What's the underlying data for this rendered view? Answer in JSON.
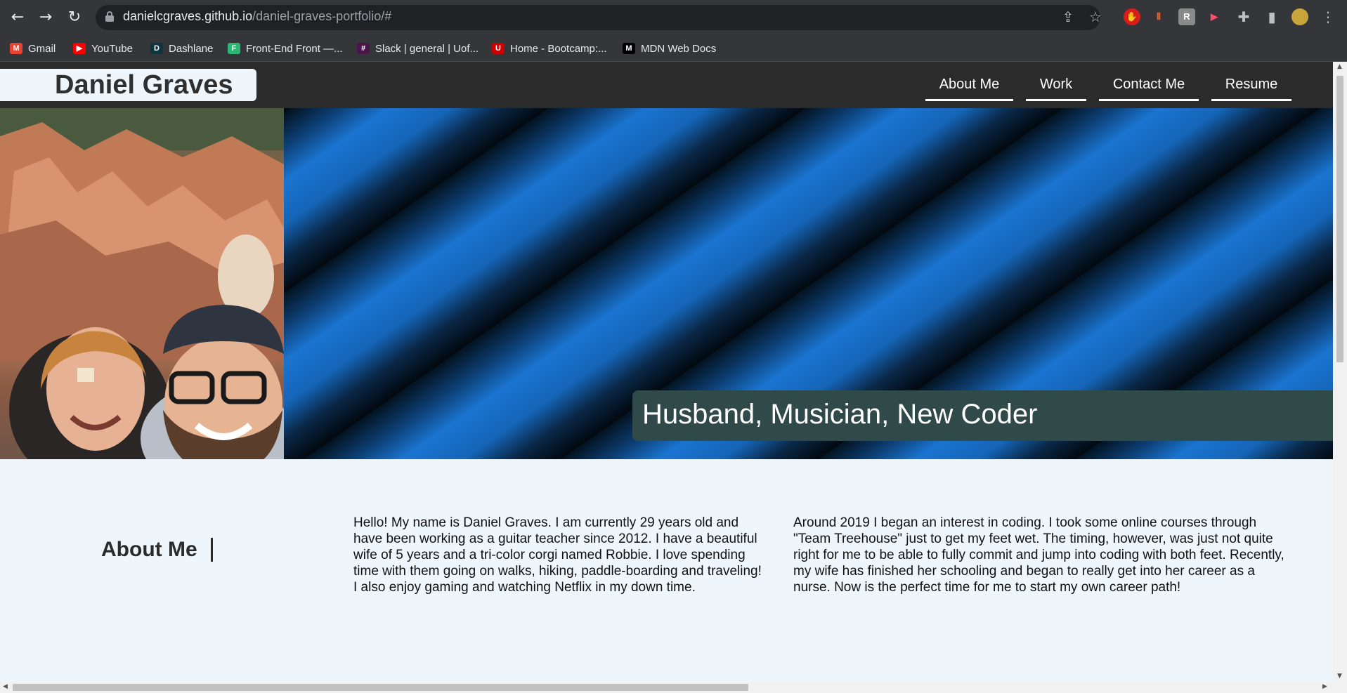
{
  "browser": {
    "url_host": "danielcgraves.github.io",
    "url_path": "/daniel-graves-portfolio/#",
    "bookmarks": [
      {
        "label": "Gmail",
        "icon": "gmail-icon",
        "color": "#ea4335"
      },
      {
        "label": "YouTube",
        "icon": "youtube-icon",
        "color": "#ff0000"
      },
      {
        "label": "Dashlane",
        "icon": "dashlane-icon",
        "color": "#0e353d"
      },
      {
        "label": "Front-End Front —...",
        "icon": "front-end-front-icon",
        "color": "#2bb673"
      },
      {
        "label": "Slack | general | Uof...",
        "icon": "slack-icon",
        "color": "#4a154b"
      },
      {
        "label": "Home - Bootcamp:...",
        "icon": "bootcamp-icon",
        "color": "#cc0000"
      },
      {
        "label": "MDN Web Docs",
        "icon": "mdn-icon",
        "color": "#000000"
      }
    ]
  },
  "site": {
    "brand": "Daniel Graves",
    "nav": [
      "About Me",
      "Work",
      "Contact Me",
      "Resume"
    ],
    "tagline": "Husband, Musician, New Coder",
    "about": {
      "heading": "About Me",
      "paragraph_1": "Hello! My name is Daniel Graves. I am currently 29 years old and have been working as a guitar teacher since 2012. I have a beautiful wife of 5 years and a tri-color corgi named Robbie. I love spending time with them going on walks, hiking, paddle-boarding and traveling! I also enjoy gaming and watching Netflix in my down time.",
      "paragraph_2": "Around 2019 I began an interest in coding. I took some online courses through \"Team Treehouse\" just to get my feet wet. The timing, however, was just not quite right for me to be able to fully commit and jump into coding with both feet. Recently, my wife has finished her schooling and began to really get into her career as a nurse. Now is the perfect time for me to start my own career path!"
    }
  },
  "colors": {
    "header_bg": "#2b2b2b",
    "page_bg": "#eef6fc",
    "tagline_bg": "#2f4a48",
    "stripe_blue": "#1a74d0"
  }
}
